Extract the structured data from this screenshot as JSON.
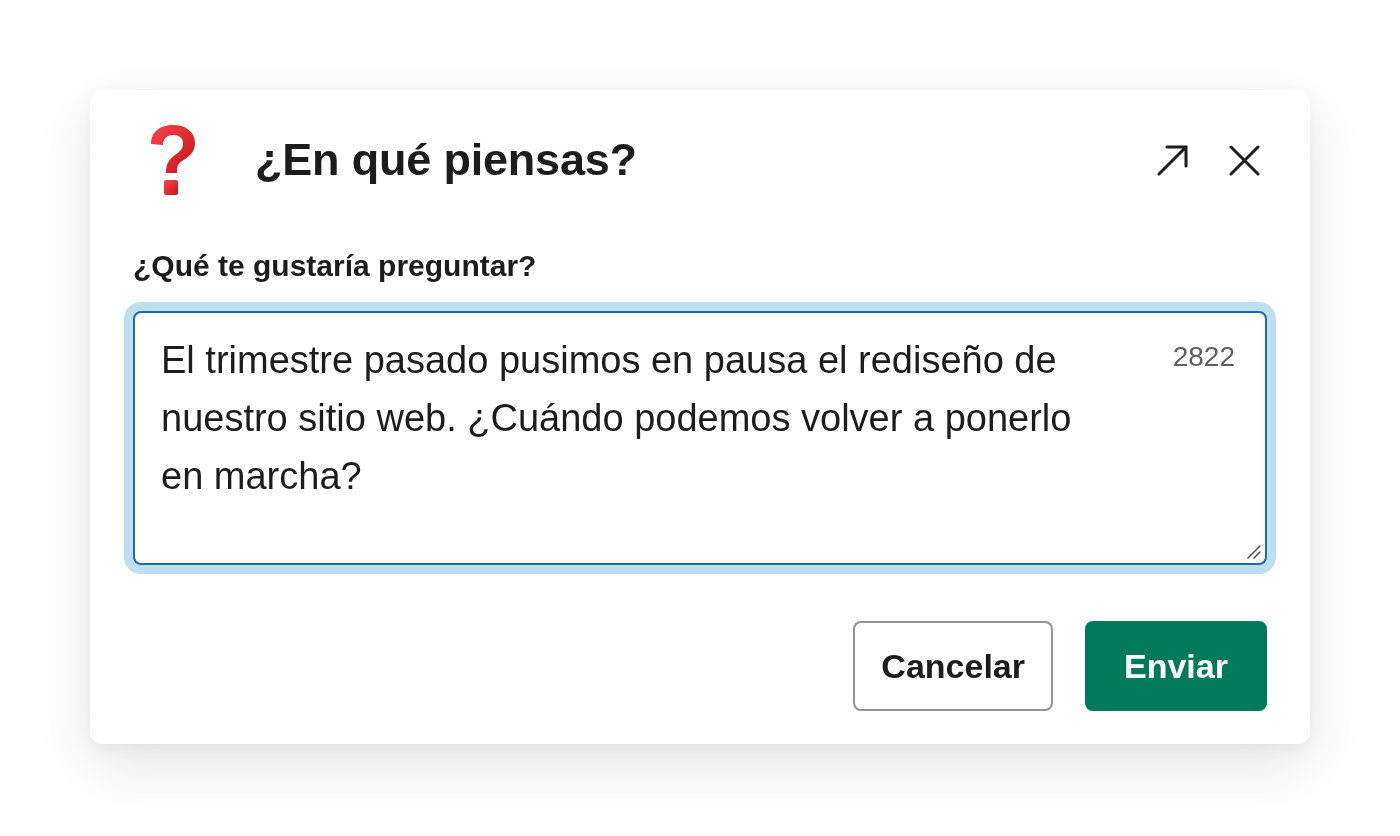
{
  "dialog": {
    "title": "¿En qué piensas?",
    "field": {
      "label": "¿Qué te gustaría preguntar?",
      "value": "El trimestre pasado pusimos en pausa el rediseño de nuestro sitio web. ¿Cuándo podemos volver a ponerlo en marcha?",
      "counter": "2822",
      "focused": true
    },
    "buttons": [
      {
        "label": "Cancelar",
        "kind": "secondary"
      },
      {
        "label": "Enviar",
        "kind": "primary"
      }
    ]
  }
}
